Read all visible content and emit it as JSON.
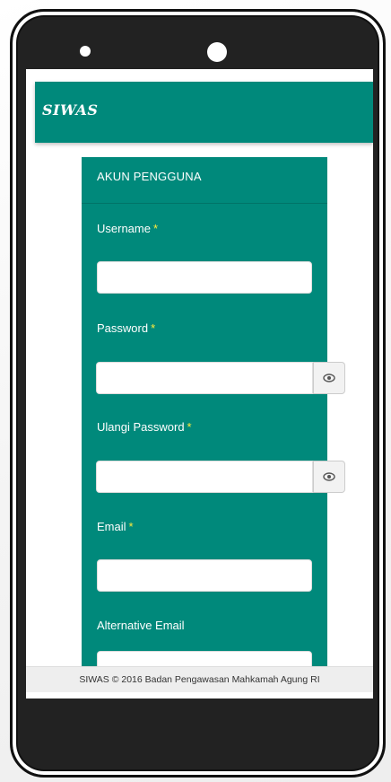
{
  "app": {
    "logo": "SIWAS"
  },
  "form": {
    "title": "AKUN PENGGUNA",
    "fields": {
      "username": {
        "label": "Username",
        "required": "*",
        "value": ""
      },
      "password": {
        "label": "Password",
        "required": "*",
        "value": ""
      },
      "repeat_password": {
        "label": "Ulangi Password",
        "required": "*",
        "value": ""
      },
      "email": {
        "label": "Email",
        "required": "*",
        "value": ""
      },
      "alt_email": {
        "label": "Alternative Email",
        "value": ""
      }
    }
  },
  "footer": {
    "text": "SIWAS © 2016 Badan Pengawasan Mahkamah Agung RI"
  },
  "colors": {
    "primary": "#00897b",
    "required": "#ffeb3b"
  },
  "icons": {
    "password_toggle": "eye-icon"
  }
}
